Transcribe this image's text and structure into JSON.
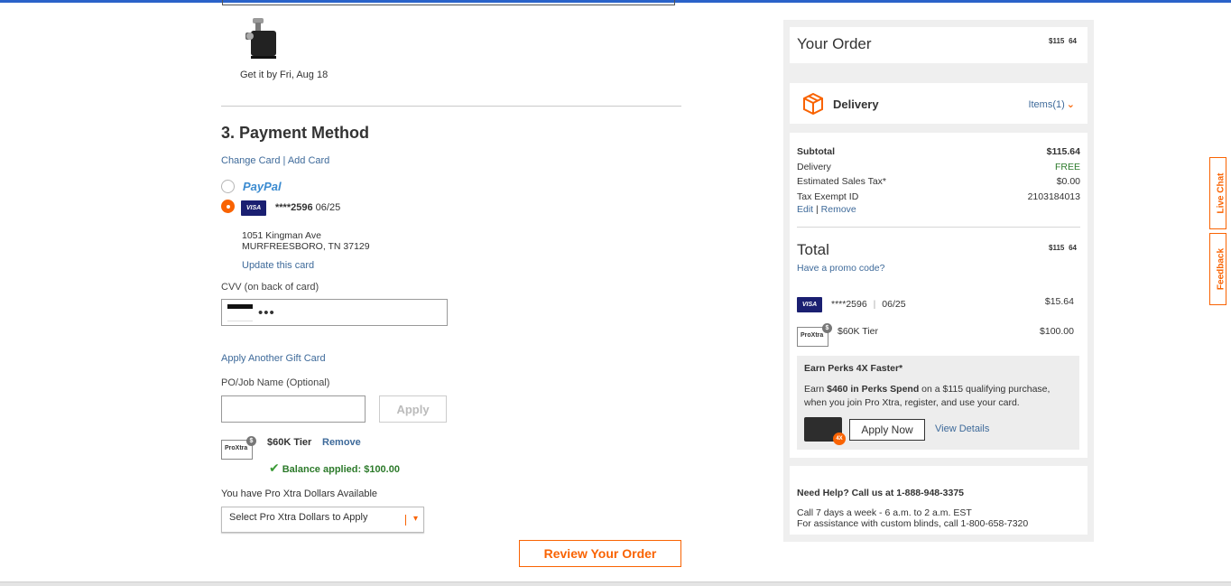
{
  "product": {
    "delivery_date": "Get it by Fri, Aug 18"
  },
  "payment": {
    "section_title": "3. Payment Method",
    "change_card": "Change Card",
    "separator": "|",
    "add_card": "Add Card",
    "paypal_label": "PayPal",
    "visa_badge": "VISA",
    "card_number": "****2596",
    "card_expiry": "06/25",
    "address_line1": "1051 Kingman Ave",
    "address_line2": "MURFREESBORO, TN 37129",
    "update_card": "Update this card",
    "cvv_label": "CVV (on back of card)",
    "cvv_value": "•••",
    "apply_gift_card": "Apply Another Gift Card",
    "po_label": "PO/Job Name (Optional)",
    "po_value": "",
    "apply_button": "Apply",
    "tier_label": "$60K Tier",
    "remove_link": "Remove",
    "balance_applied": "Balance applied: $100.00",
    "pro_xtra_available": "You have Pro Xtra Dollars Available",
    "pro_xtra_select": "Select Pro Xtra Dollars to Apply",
    "review_button": "Review Your Order",
    "proxtra_logo_text": "ProXtra"
  },
  "summary": {
    "title": "Your Order",
    "order_price_dollars": "$115",
    "order_price_cents": "64",
    "delivery_label": "Delivery",
    "items_link": "Items(1)",
    "subtotal_label": "Subtotal",
    "subtotal_value": "$115.64",
    "delivery_row_label": "Delivery",
    "delivery_row_value": "FREE",
    "tax_label": "Estimated Sales Tax*",
    "tax_value": "$0.00",
    "tax_exempt_label": "Tax Exempt ID",
    "tax_exempt_value": "2103184013",
    "edit_link": "Edit",
    "edit_sep": "|",
    "remove_link": "Remove",
    "total_label": "Total",
    "total_dollars": "$115",
    "total_cents": "64",
    "promo_link": "Have a promo code?",
    "pay_card_number": "****2596",
    "pay_card_sep": "|",
    "pay_card_expiry": "06/25",
    "pay_card_amount": "$15.64",
    "pay_tier_label": "$60K Tier",
    "pay_tier_amount": "$100.00"
  },
  "perks": {
    "title": "Earn Perks 4X Faster*",
    "body_prefix": "Earn ",
    "body_bold": "$460 in Perks Spend",
    "body_suffix": " on a $115 qualifying purchase, when you join Pro Xtra, register, and use your card.",
    "badge": "4X",
    "apply_now": "Apply Now",
    "view_details": "View Details"
  },
  "help": {
    "title": "Need Help? Call us at 1-888-948-3375",
    "line1": "Call 7 days a week - 6 a.m. to 2 a.m. EST",
    "line2": "For assistance with custom blinds, call 1-800-658-7320"
  },
  "side_tabs": {
    "live_chat": "Live Chat",
    "feedback": "Feedback"
  },
  "colors": {
    "accent": "#f96302",
    "link": "#3e6a9a",
    "success": "#2c7a2a",
    "visa": "#1a1f71"
  },
  "icons": {
    "delivery": "box-icon",
    "checkmark": "checkmark-icon",
    "chevron": "chevron-down-icon"
  }
}
